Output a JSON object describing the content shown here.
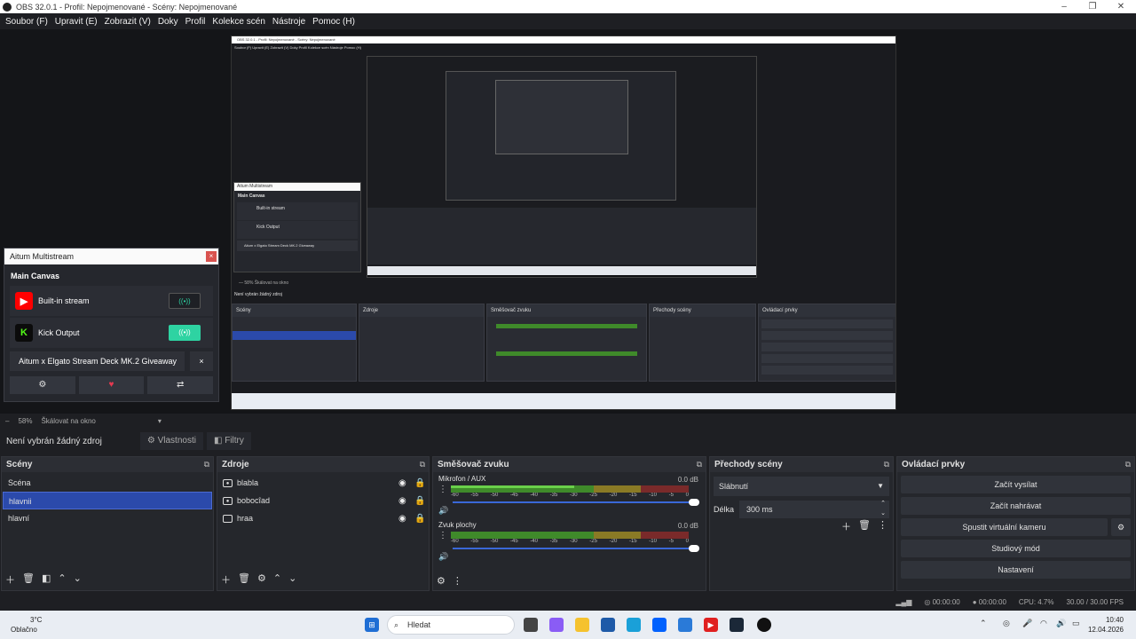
{
  "window": {
    "title": "OBS 32.0.1 - Profil: Nepojmenované - Scény: Nepojmenované"
  },
  "menu": [
    "Soubor (F)",
    "Upravit (E)",
    "Zobrazit (V)",
    "Doky",
    "Profil",
    "Kolekce scén",
    "Nástroje",
    "Pomoc (H)"
  ],
  "multistream": {
    "title": "Aitum Multistream",
    "section": "Main Canvas",
    "outputs": [
      {
        "label": "Built-in stream",
        "toggle_on": false
      },
      {
        "label": "Kick Output",
        "toggle_on": true
      }
    ],
    "event": "Aitum x Elgato Stream Deck MK.2 Giveaway",
    "close_glyph": "×"
  },
  "zoombar": {
    "zoom": "58%",
    "scale": "Škálovat na okno",
    "minus": "–"
  },
  "sourcebar": {
    "status": "Není vybrán žádný zdroj",
    "properties": "Vlastnosti",
    "filters": "Filtry"
  },
  "scenes": {
    "title": "Scény",
    "items": [
      "Scéna",
      "hlavnii",
      "hlavní"
    ],
    "selected": 1
  },
  "sources": {
    "title": "Zdroje",
    "items": [
      {
        "name": "blabla",
        "type": "camera"
      },
      {
        "name": "bobocîad",
        "type": "camera"
      },
      {
        "name": "hraa",
        "type": "monitor"
      }
    ]
  },
  "mixer": {
    "title": "Směšovač zvuku",
    "channels": [
      {
        "name": "Mikrofon / AUX",
        "db": "0.0 dB",
        "level": 0.52
      },
      {
        "name": "Zvuk plochy",
        "db": "0.0 dB",
        "level": 0.0
      }
    ],
    "ticks": [
      "-60",
      "-55",
      "-50",
      "-45",
      "-40",
      "-35",
      "-30",
      "-25",
      "-20",
      "-15",
      "-10",
      "-5",
      "0"
    ]
  },
  "transitions": {
    "title": "Přechody scény",
    "selected": "Slábnutí",
    "duration_label": "Délka",
    "duration": "300 ms"
  },
  "controls": {
    "title": "Ovládací prvky",
    "buttons": [
      "Začít vysílat",
      "Začít nahrávat",
      "Spustit virtuální kameru",
      "Studiový mód",
      "Nastavení"
    ]
  },
  "status": {
    "rec_time": "00:00:00",
    "stream_time": "00:00:00",
    "cpu": "CPU: 4.7%",
    "fps": "30.00 / 30.00 FPS"
  },
  "taskbar": {
    "weather_temp": "3°C",
    "weather_desc": "Oblačno",
    "search": "Hledat",
    "time": "10:40",
    "date": "12.04.2026"
  },
  "nested": {
    "title": "OBS 32.0.1 - Profil: Nepojmenované - Scény: Nepojmenované",
    "menu": "Soubor (F)   Upravit (E)   Zobrazit (V)   Doky   Profil   Kolekce scén   Nástroje   Pomoc (H)",
    "status": "Není vybrán žádný zdroj",
    "ms_title": "Aitum Multistream",
    "ms_section": "Main Canvas",
    "ms_out1": "Built-in stream",
    "ms_out2": "Kick Output",
    "ms_event": "Aitum x Elgato Stream Deck MK.2 Giveaway"
  },
  "colors": {
    "accent": "#2b4aab",
    "kick": "#53fc18",
    "youtube": "#ff0000",
    "toggle_on": "#2ed3a2"
  }
}
